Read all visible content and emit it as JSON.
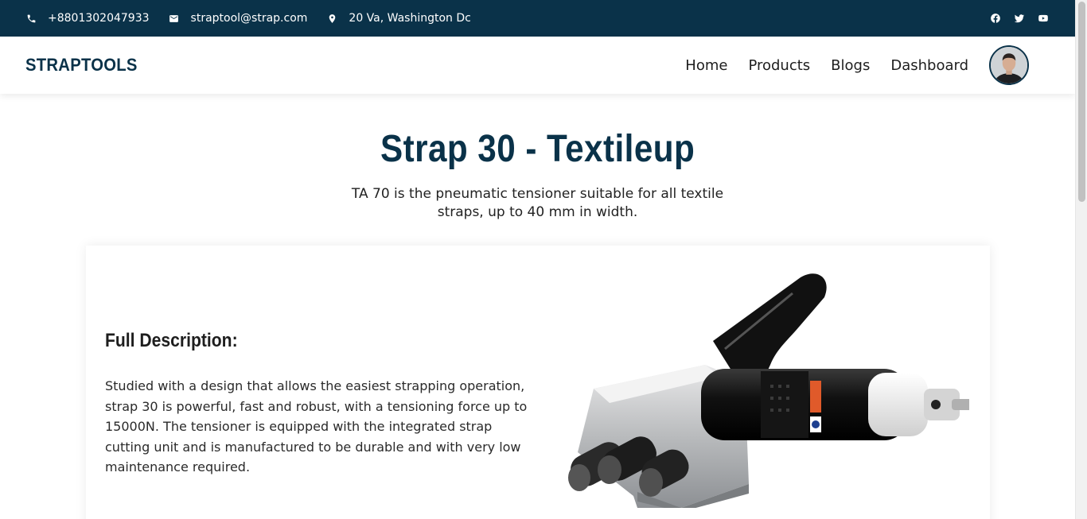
{
  "topbar": {
    "phone": "+8801302047933",
    "email": "straptool@strap.com",
    "address": "20 Va, Washington Dc",
    "icons": {
      "phone": "phone-icon",
      "email": "mail-icon",
      "location": "location-pin-icon",
      "facebook": "facebook-icon",
      "twitter": "twitter-icon",
      "youtube": "youtube-icon"
    }
  },
  "navbar": {
    "brand": "STRAPTOOLS",
    "links": [
      "Home",
      "Products",
      "Blogs",
      "Dashboard"
    ]
  },
  "product": {
    "title": "Strap 30 - Textileup",
    "subtitle": "TA 70 is the pneumatic tensioner suitable for all textile straps, up to 40 mm in width.",
    "description_heading": "Full Description:",
    "description": "Studied with a design that allows the easiest strapping operation, strap 30 is powerful, fast and robust, with a tensioning force up to 15000N. The tensioner is equipped with the integrated strap cutting unit and is manufactured to be durable and with very low maintenance required."
  },
  "colors": {
    "primary": "#0a3249",
    "text": "#222222",
    "background": "#ffffff"
  }
}
